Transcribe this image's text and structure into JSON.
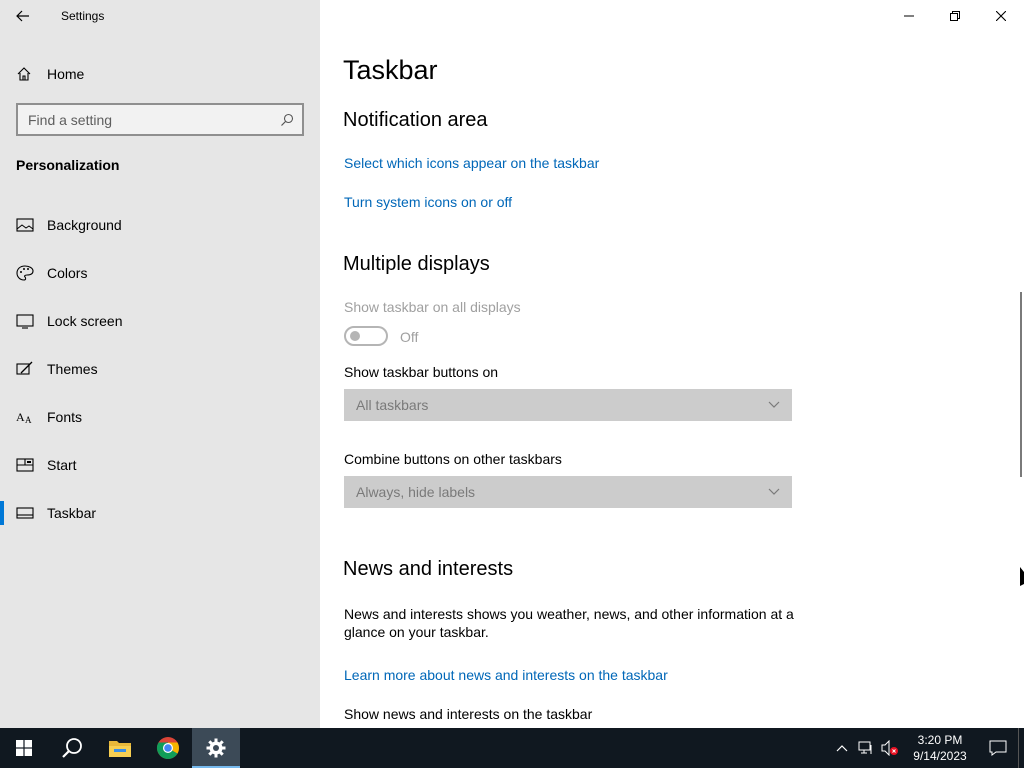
{
  "window": {
    "app_title": "Settings"
  },
  "sidebar": {
    "home_label": "Home",
    "search_placeholder": "Find a setting",
    "section_title": "Personalization",
    "items": [
      {
        "label": "Background",
        "icon": "picture-icon"
      },
      {
        "label": "Colors",
        "icon": "palette-icon"
      },
      {
        "label": "Lock screen",
        "icon": "monitor-icon"
      },
      {
        "label": "Themes",
        "icon": "brush-icon"
      },
      {
        "label": "Fonts",
        "icon": "font-icon"
      },
      {
        "label": "Start",
        "icon": "start-tiles-icon"
      },
      {
        "label": "Taskbar",
        "icon": "taskbar-icon",
        "active": true
      }
    ]
  },
  "main": {
    "page_title": "Taskbar",
    "notification_area": {
      "heading": "Notification area",
      "link_icons": "Select which icons appear on the taskbar",
      "link_system_icons": "Turn system icons on or off"
    },
    "multiple_displays": {
      "heading": "Multiple displays",
      "show_all_label": "Show taskbar on all displays",
      "toggle_state": "Off",
      "buttons_on_label": "Show taskbar buttons on",
      "buttons_on_value": "All taskbars",
      "combine_label": "Combine buttons on other taskbars",
      "combine_value": "Always, hide labels"
    },
    "news": {
      "heading": "News and interests",
      "description": "News and interests shows you weather, news, and other information at a glance on your taskbar.",
      "learn_more": "Learn more about news and interests on the taskbar",
      "show_label": "Show news and interests on the taskbar"
    }
  },
  "taskbar": {
    "time": "3:20 PM",
    "date": "9/14/2023",
    "accent": "#0078d7"
  }
}
